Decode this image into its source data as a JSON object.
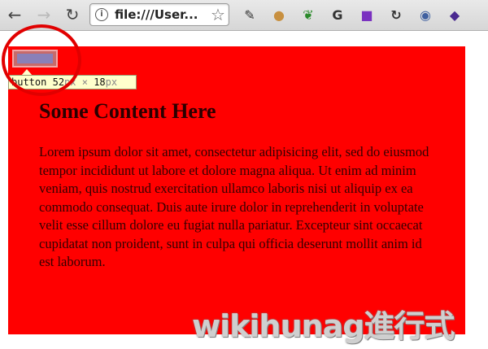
{
  "browser": {
    "back_glyph": "←",
    "forward_glyph": "→",
    "reload_glyph": "↻",
    "address_text": "file:///User...",
    "page_icon_glyph": "i",
    "star_glyph": "☆",
    "extensions": [
      {
        "name": "tool-icon",
        "glyph": "✎",
        "color": "#333333"
      },
      {
        "name": "cookie-icon",
        "glyph": "●",
        "color": "#c89040"
      },
      {
        "name": "leaf-icon",
        "glyph": "❦",
        "color": "#2a8a2a"
      },
      {
        "name": "g-icon",
        "glyph": "G",
        "color": "#333333"
      },
      {
        "name": "color-picker-icon",
        "glyph": "■",
        "color": "#7a30c0"
      },
      {
        "name": "sync-icon",
        "glyph": "↻",
        "color": "#333333"
      },
      {
        "name": "globe-icon",
        "glyph": "◉",
        "color": "#4060a0"
      },
      {
        "name": "extension-icon",
        "glyph": "◆",
        "color": "#4a2a90"
      }
    ]
  },
  "inspector": {
    "tag": "button",
    "width": "52",
    "height": "18",
    "unit": "px",
    "times": " × "
  },
  "page": {
    "heading": "Some Content Here",
    "paragraph": "Lorem ipsum dolor sit amet, consectetur adipisicing elit, sed do eiusmod tempor incididunt ut labore et dolore magna aliqua. Ut enim ad minim veniam, quis nostrud exercitation ullamco laboris nisi ut aliquip ex ea commodo consequat. Duis aute irure dolor in reprehenderit in voluptate velit esse cillum dolore eu fugiat nulla pariatur. Excepteur sint occaecat cupidatat non proident, sunt in culpa qui officia deserunt mollit anim id est laborum."
  },
  "watermark": "wikihunag進行式",
  "colors": {
    "content_background": "#ff0000",
    "annotation": "#e10000",
    "tooltip_background": "#ffffcc"
  }
}
